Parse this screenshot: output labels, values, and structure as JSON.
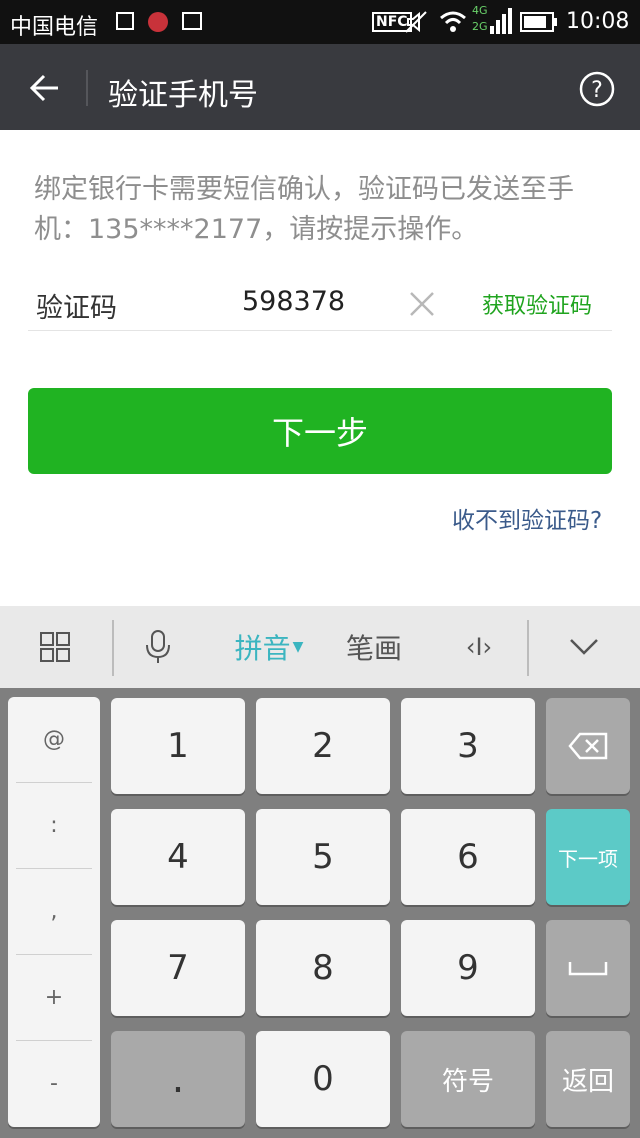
{
  "status_bar": {
    "carrier": "中国电信",
    "nfc": "NFC",
    "network": "4G",
    "network2": "2G",
    "time": "10:08"
  },
  "title_bar": {
    "title": "验证手机号"
  },
  "hint": "绑定银行卡需要短信确认，验证码已发送至手机：135****2177，请按提示操作。",
  "code_row": {
    "label": "验证码",
    "value": "598378",
    "get_code": "获取验证码"
  },
  "next_button": "下一步",
  "no_code_link": "收不到验证码?",
  "keyboard": {
    "toolbar": {
      "pinyin": "拼音",
      "stroke": "笔画",
      "cursor": "‹I›"
    },
    "symbols": [
      "@",
      ":",
      ",",
      "+",
      "-"
    ],
    "keys": {
      "k1": "1",
      "k2": "2",
      "k3": "3",
      "k4": "4",
      "k5": "5",
      "k6": "6",
      "k7": "7",
      "k8": "8",
      "k9": "9",
      "dot": ".",
      "k0": "0",
      "symbols_key": "符号",
      "next_item": "下一项",
      "return": "返回"
    }
  }
}
